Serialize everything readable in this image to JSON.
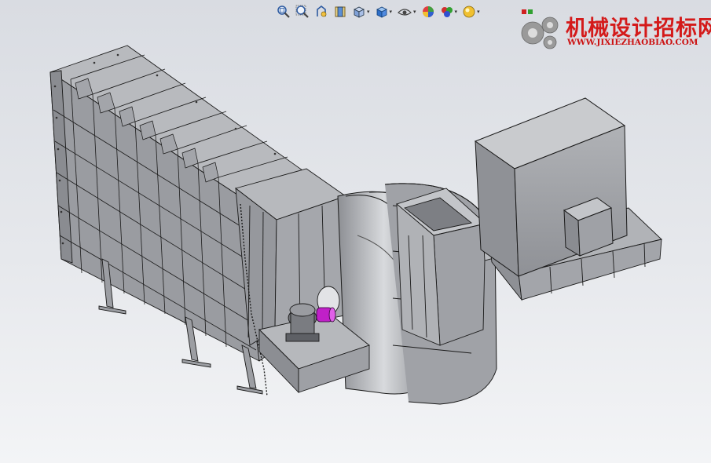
{
  "toolbar": {
    "icons": [
      {
        "name": "zoom-to-fit-icon",
        "caret": false
      },
      {
        "name": "zoom-to-area-icon",
        "caret": false
      },
      {
        "name": "previous-view-icon",
        "caret": false
      },
      {
        "name": "section-view-icon",
        "caret": false
      },
      {
        "name": "view-orientation-icon",
        "caret": true
      },
      {
        "name": "display-style-icon",
        "caret": true
      },
      {
        "name": "hide-show-items-icon",
        "caret": true
      },
      {
        "name": "edit-appearance-icon",
        "caret": false
      },
      {
        "name": "apply-scene-icon",
        "caret": true
      },
      {
        "name": "view-settings-icon",
        "caret": true
      }
    ],
    "caret_glyph": "▾"
  },
  "watermark": {
    "title": "机械设计招标网",
    "url": "WWW.JIXIEZHAOBIAO.COM",
    "colors": {
      "title": "#d41a1a",
      "gear": "#9a9a9a"
    }
  },
  "model": {
    "description_colors": {
      "steel": "#a9abb0",
      "edge": "#1a1a1a",
      "coupling": "#c020c8"
    }
  }
}
